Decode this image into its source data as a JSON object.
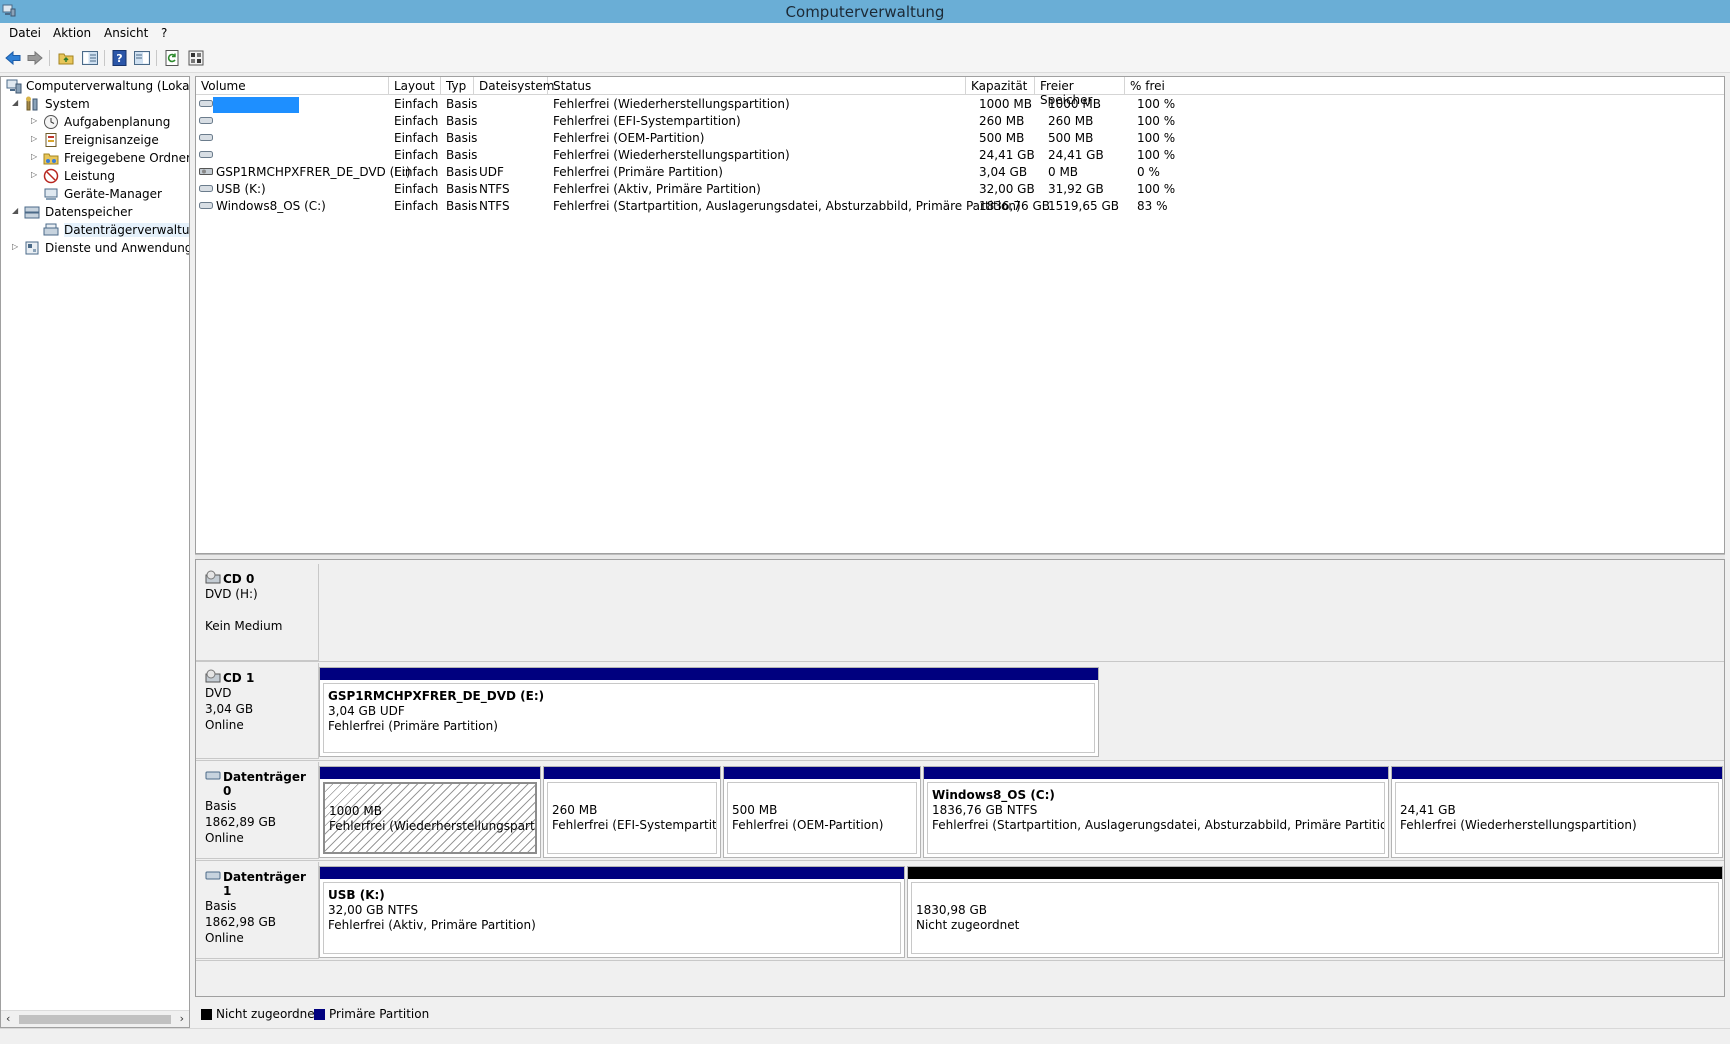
{
  "window": {
    "title": "Computerverwaltung"
  },
  "menu": {
    "items": [
      "Datei",
      "Aktion",
      "Ansicht",
      "?"
    ]
  },
  "tree": {
    "root": "Computerverwaltung (Lokal)",
    "system": "System",
    "aufgabenplanung": "Aufgabenplanung",
    "ereignisanzeige": "Ereignisanzeige",
    "freigegebene_ordner": "Freigegebene Ordner",
    "leistung": "Leistung",
    "geraete_manager": "Geräte-Manager",
    "datenspeicher": "Datenspeicher",
    "datentraegerverwaltung": "Datenträgerverwaltung",
    "dienste": "Dienste und Anwendungen"
  },
  "volumes": {
    "columns": [
      "Volume",
      "Layout",
      "Typ",
      "Dateisystem",
      "Status",
      "Kapazität",
      "Freier Speicher",
      "% frei"
    ],
    "rows": [
      {
        "volume": "",
        "layout": "Einfach",
        "typ": "Basis",
        "fs": "",
        "status": "Fehlerfrei (Wiederherstellungspartition)",
        "kap": "1000 MB",
        "frei": "1000 MB",
        "pct": "100 %"
      },
      {
        "volume": "",
        "layout": "Einfach",
        "typ": "Basis",
        "fs": "",
        "status": "Fehlerfrei (EFI-Systempartition)",
        "kap": "260 MB",
        "frei": "260 MB",
        "pct": "100 %"
      },
      {
        "volume": "",
        "layout": "Einfach",
        "typ": "Basis",
        "fs": "",
        "status": "Fehlerfrei (OEM-Partition)",
        "kap": "500 MB",
        "frei": "500 MB",
        "pct": "100 %"
      },
      {
        "volume": "",
        "layout": "Einfach",
        "typ": "Basis",
        "fs": "",
        "status": "Fehlerfrei (Wiederherstellungspartition)",
        "kap": "24,41 GB",
        "frei": "24,41 GB",
        "pct": "100 %"
      },
      {
        "volume": "GSP1RMCHPXFRER_DE_DVD (E:)",
        "layout": "Einfach",
        "typ": "Basis",
        "fs": "UDF",
        "status": "Fehlerfrei (Primäre Partition)",
        "kap": "3,04 GB",
        "frei": "0 MB",
        "pct": "0 %"
      },
      {
        "volume": "USB (K:)",
        "layout": "Einfach",
        "typ": "Basis",
        "fs": "NTFS",
        "status": "Fehlerfrei (Aktiv, Primäre Partition)",
        "kap": "32,00 GB",
        "frei": "31,92 GB",
        "pct": "100 %"
      },
      {
        "volume": "Windows8_OS (C:)",
        "layout": "Einfach",
        "typ": "Basis",
        "fs": "NTFS",
        "status": "Fehlerfrei (Startpartition, Auslagerungsdatei, Absturzabbild, Primäre Partition)",
        "kap": "1836,76 GB",
        "frei": "1519,65 GB",
        "pct": "83 %"
      }
    ]
  },
  "disks": {
    "cd0": {
      "name": "CD 0",
      "line1": "DVD (H:)",
      "line2": "",
      "line3": "Kein Medium"
    },
    "cd1": {
      "name": "CD 1",
      "line1": "DVD",
      "line2": "3,04 GB",
      "line3": "Online",
      "p1": {
        "name": "GSP1RMCHPXFRER_DE_DVD  (E:)",
        "size": "3,04 GB UDF",
        "status": "Fehlerfrei (Primäre Partition)"
      }
    },
    "disk0": {
      "name": "Datenträger 0",
      "line1": "Basis",
      "line2": "1862,89 GB",
      "line3": "Online",
      "p1": {
        "size": "1000 MB",
        "status": "Fehlerfrei (Wiederherstellungspartition)"
      },
      "p2": {
        "size": "260 MB",
        "status": "Fehlerfrei (EFI-Systempartition)"
      },
      "p3": {
        "size": "500 MB",
        "status": "Fehlerfrei (OEM-Partition)"
      },
      "p4": {
        "name": "Windows8_OS  (C:)",
        "size": "1836,76 GB NTFS",
        "status": "Fehlerfrei (Startpartition, Auslagerungsdatei, Absturzabbild, Primäre Partition)"
      },
      "p5": {
        "size": "24,41 GB",
        "status": "Fehlerfrei (Wiederherstellungspartition)"
      }
    },
    "disk1": {
      "name": "Datenträger 1",
      "line1": "Basis",
      "line2": "1862,98 GB",
      "line3": "Online",
      "p1": {
        "name": "USB  (K:)",
        "size": "32,00 GB NTFS",
        "status": "Fehlerfrei (Aktiv, Primäre Partition)"
      },
      "p2": {
        "size": "1830,98 GB",
        "status": "Nicht zugeordnet"
      }
    }
  },
  "legend": {
    "unallocated": "Nicht zugeordnet",
    "primary": "Primäre Partition"
  },
  "colors": {
    "primary_partition": "#00007f",
    "unallocated": "#000000",
    "titlebar": "#6aaed6",
    "selection": "#1e8fff"
  }
}
